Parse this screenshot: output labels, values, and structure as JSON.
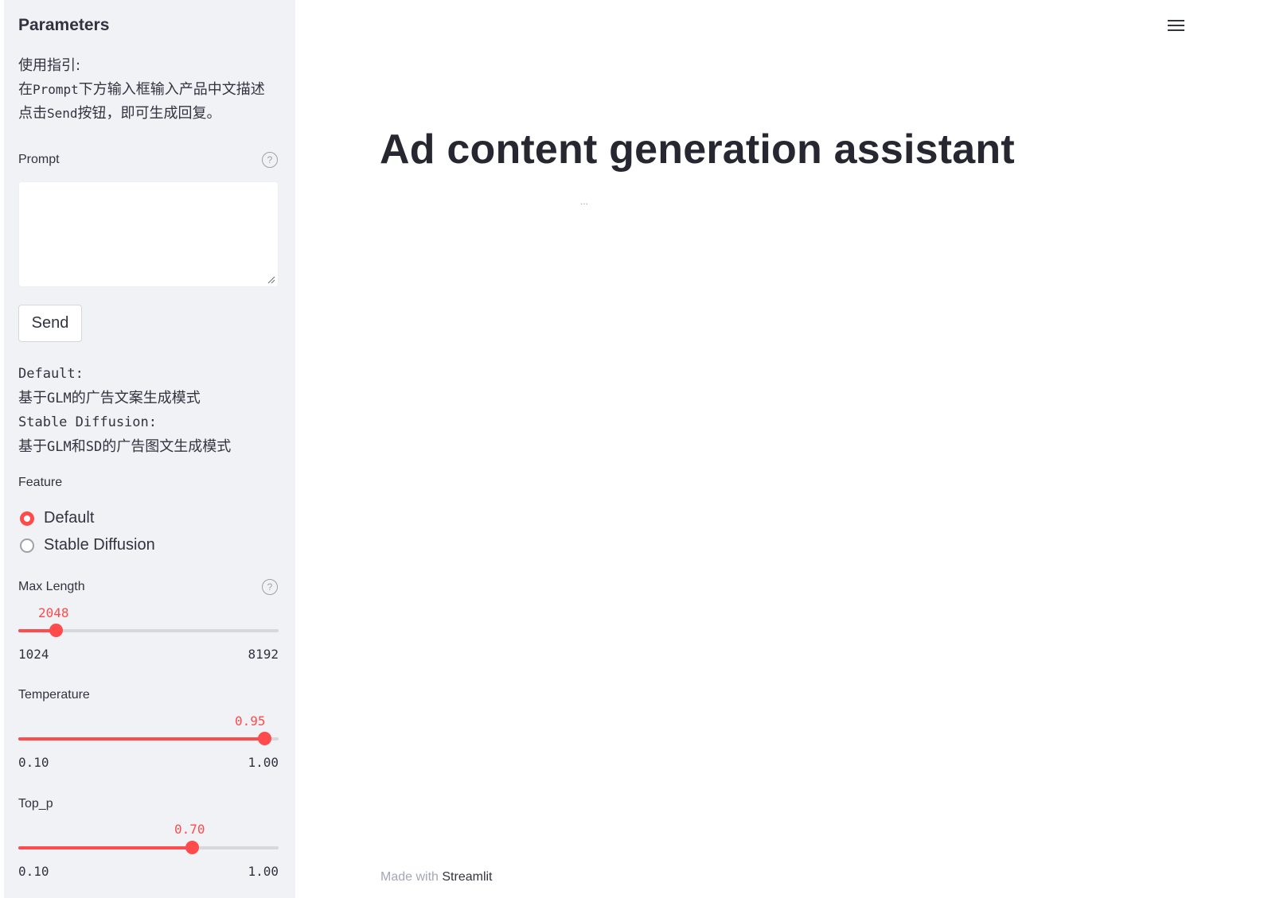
{
  "sidebar": {
    "header": "Parameters",
    "guide": {
      "line1": "使用指引:",
      "line2_pre": "在",
      "line2_mono": "Prompt",
      "line2_post": "下方输入框输入产品中文描述",
      "line3_pre": "点击",
      "line3_mono": "Send",
      "line3_post": "按钮，即可生成回复。"
    },
    "prompt": {
      "label": "Prompt",
      "value": "",
      "help_icon": "question-circle-icon"
    },
    "send_label": "Send",
    "modes": {
      "default_name": "Default:",
      "default_desc_pre": "基于",
      "default_desc_mono": "GLM",
      "default_desc_post": "的广告文案生成模式",
      "sd_name": "Stable Diffusion:",
      "sd_desc_pre": "基于",
      "sd_desc_mono1": "GLM",
      "sd_desc_mid": "和",
      "sd_desc_mono2": "SD",
      "sd_desc_post": "的广告图文生成模式"
    },
    "feature": {
      "label": "Feature",
      "options": [
        "Default",
        "Stable Diffusion"
      ],
      "selected": "Default"
    },
    "max_length": {
      "label": "Max Length",
      "value": "2048",
      "min": "1024",
      "max": "8192",
      "fraction": 0.143
    },
    "temperature": {
      "label": "Temperature",
      "value": "0.95",
      "min": "0.10",
      "max": "1.00",
      "fraction": 0.944
    },
    "top_p": {
      "label": "Top_p",
      "value": "0.70",
      "min": "0.10",
      "max": "1.00",
      "fraction": 0.667
    }
  },
  "main": {
    "menu_icon": "hamburger-menu-icon",
    "title": "Ad content generation assistant",
    "loading": "...",
    "footer_pre": "Made with",
    "footer_brand": "Streamlit"
  },
  "colors": {
    "accent": "#ff4b4b",
    "sidebar_bg": "#f0f2f6",
    "text": "#31333f"
  }
}
